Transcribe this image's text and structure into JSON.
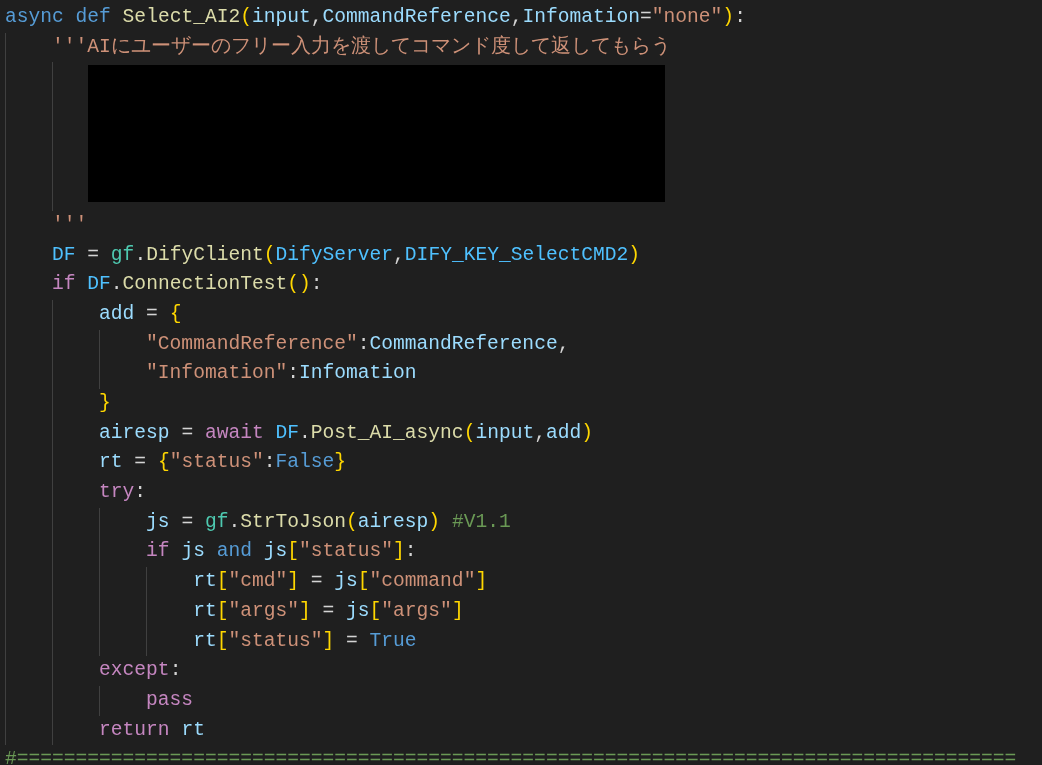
{
  "editor": {
    "lines": [
      {
        "kind": "code",
        "tokens": [
          {
            "kind": "keyword",
            "text": "async "
          },
          {
            "kind": "keyword",
            "text": "def "
          },
          {
            "kind": "function",
            "text": "Select_AI2"
          },
          {
            "kind": "bracket",
            "text": "("
          },
          {
            "kind": "variable",
            "text": "input"
          },
          {
            "kind": "plain",
            "text": ","
          },
          {
            "kind": "variable",
            "text": "CommandReference"
          },
          {
            "kind": "plain",
            "text": ","
          },
          {
            "kind": "variable",
            "text": "Infomation"
          },
          {
            "kind": "plain",
            "text": "="
          },
          {
            "kind": "string",
            "text": "\"none\""
          },
          {
            "kind": "bracket",
            "text": ")"
          },
          {
            "kind": "plain",
            "text": ":"
          }
        ],
        "children": [
          {
            "kind": "code",
            "tokens": [
              {
                "kind": "string",
                "text": "'''AIにユーザーのフリー入力を渡してコマンド度して返してもらう"
              }
            ],
            "children": [
              {
                "kind": "redacted"
              }
            ]
          },
          {
            "kind": "code",
            "tokens": [
              {
                "kind": "string",
                "text": "'''"
              }
            ]
          },
          {
            "kind": "code",
            "tokens": [
              {
                "kind": "constant",
                "text": "DF"
              },
              {
                "kind": "plain",
                "text": " = "
              },
              {
                "kind": "module",
                "text": "gf"
              },
              {
                "kind": "plain",
                "text": "."
              },
              {
                "kind": "function",
                "text": "DifyClient"
              },
              {
                "kind": "bracket",
                "text": "("
              },
              {
                "kind": "constant",
                "text": "DifyServer"
              },
              {
                "kind": "plain",
                "text": ","
              },
              {
                "kind": "constant",
                "text": "DIFY_KEY_SelectCMD2"
              },
              {
                "kind": "bracket",
                "text": ")"
              }
            ]
          },
          {
            "kind": "code",
            "tokens": [
              {
                "kind": "control",
                "text": "if "
              },
              {
                "kind": "constant",
                "text": "DF"
              },
              {
                "kind": "plain",
                "text": "."
              },
              {
                "kind": "function",
                "text": "ConnectionTest"
              },
              {
                "kind": "bracket",
                "text": "()"
              },
              {
                "kind": "plain",
                "text": ":"
              }
            ],
            "children": [
              {
                "kind": "code",
                "tokens": [
                  {
                    "kind": "variable",
                    "text": "add"
                  },
                  {
                    "kind": "plain",
                    "text": " = "
                  },
                  {
                    "kind": "bracket",
                    "text": "{"
                  }
                ],
                "children": [
                  {
                    "kind": "code",
                    "tokens": [
                      {
                        "kind": "string",
                        "text": "\"CommandReference\""
                      },
                      {
                        "kind": "plain",
                        "text": ":"
                      },
                      {
                        "kind": "variable",
                        "text": "CommandReference"
                      },
                      {
                        "kind": "plain",
                        "text": ","
                      }
                    ]
                  },
                  {
                    "kind": "code",
                    "tokens": [
                      {
                        "kind": "string",
                        "text": "\"Infomation\""
                      },
                      {
                        "kind": "plain",
                        "text": ":"
                      },
                      {
                        "kind": "variable",
                        "text": "Infomation"
                      }
                    ]
                  }
                ]
              },
              {
                "kind": "code",
                "tokens": [
                  {
                    "kind": "bracket",
                    "text": "}"
                  }
                ]
              },
              {
                "kind": "code",
                "tokens": [
                  {
                    "kind": "variable",
                    "text": "airesp"
                  },
                  {
                    "kind": "plain",
                    "text": " = "
                  },
                  {
                    "kind": "control",
                    "text": "await "
                  },
                  {
                    "kind": "constant",
                    "text": "DF"
                  },
                  {
                    "kind": "plain",
                    "text": "."
                  },
                  {
                    "kind": "function",
                    "text": "Post_AI_async"
                  },
                  {
                    "kind": "bracket",
                    "text": "("
                  },
                  {
                    "kind": "variable",
                    "text": "input"
                  },
                  {
                    "kind": "plain",
                    "text": ","
                  },
                  {
                    "kind": "variable",
                    "text": "add"
                  },
                  {
                    "kind": "bracket",
                    "text": ")"
                  }
                ]
              },
              {
                "kind": "code",
                "tokens": [
                  {
                    "kind": "variable",
                    "text": "rt"
                  },
                  {
                    "kind": "plain",
                    "text": " = "
                  },
                  {
                    "kind": "bracket",
                    "text": "{"
                  },
                  {
                    "kind": "string",
                    "text": "\"status\""
                  },
                  {
                    "kind": "plain",
                    "text": ":"
                  },
                  {
                    "kind": "keyword",
                    "text": "False"
                  },
                  {
                    "kind": "bracket",
                    "text": "}"
                  }
                ]
              },
              {
                "kind": "code",
                "tokens": [
                  {
                    "kind": "control",
                    "text": "try"
                  },
                  {
                    "kind": "plain",
                    "text": ":"
                  }
                ],
                "children": [
                  {
                    "kind": "code",
                    "tokens": [
                      {
                        "kind": "variable",
                        "text": "js"
                      },
                      {
                        "kind": "plain",
                        "text": " = "
                      },
                      {
                        "kind": "module",
                        "text": "gf"
                      },
                      {
                        "kind": "plain",
                        "text": "."
                      },
                      {
                        "kind": "function",
                        "text": "StrToJson"
                      },
                      {
                        "kind": "bracket",
                        "text": "("
                      },
                      {
                        "kind": "variable",
                        "text": "airesp"
                      },
                      {
                        "kind": "bracket",
                        "text": ")"
                      },
                      {
                        "kind": "comment",
                        "text": " #V1.1"
                      }
                    ]
                  },
                  {
                    "kind": "code",
                    "tokens": [
                      {
                        "kind": "control",
                        "text": "if "
                      },
                      {
                        "kind": "variable",
                        "text": "js "
                      },
                      {
                        "kind": "keyword",
                        "text": "and "
                      },
                      {
                        "kind": "variable",
                        "text": "js"
                      },
                      {
                        "kind": "bracket",
                        "text": "["
                      },
                      {
                        "kind": "string",
                        "text": "\"status\""
                      },
                      {
                        "kind": "bracket",
                        "text": "]"
                      },
                      {
                        "kind": "plain",
                        "text": ":"
                      }
                    ],
                    "children": [
                      {
                        "kind": "code",
                        "tokens": [
                          {
                            "kind": "variable",
                            "text": "rt"
                          },
                          {
                            "kind": "bracket",
                            "text": "["
                          },
                          {
                            "kind": "string",
                            "text": "\"cmd\""
                          },
                          {
                            "kind": "bracket",
                            "text": "]"
                          },
                          {
                            "kind": "plain",
                            "text": " = "
                          },
                          {
                            "kind": "variable",
                            "text": "js"
                          },
                          {
                            "kind": "bracket",
                            "text": "["
                          },
                          {
                            "kind": "string",
                            "text": "\"command\""
                          },
                          {
                            "kind": "bracket",
                            "text": "]"
                          }
                        ]
                      },
                      {
                        "kind": "code",
                        "tokens": [
                          {
                            "kind": "variable",
                            "text": "rt"
                          },
                          {
                            "kind": "bracket",
                            "text": "["
                          },
                          {
                            "kind": "string",
                            "text": "\"args\""
                          },
                          {
                            "kind": "bracket",
                            "text": "]"
                          },
                          {
                            "kind": "plain",
                            "text": " = "
                          },
                          {
                            "kind": "variable",
                            "text": "js"
                          },
                          {
                            "kind": "bracket",
                            "text": "["
                          },
                          {
                            "kind": "string",
                            "text": "\"args\""
                          },
                          {
                            "kind": "bracket",
                            "text": "]"
                          }
                        ]
                      },
                      {
                        "kind": "code",
                        "tokens": [
                          {
                            "kind": "variable",
                            "text": "rt"
                          },
                          {
                            "kind": "bracket",
                            "text": "["
                          },
                          {
                            "kind": "string",
                            "text": "\"status\""
                          },
                          {
                            "kind": "bracket",
                            "text": "]"
                          },
                          {
                            "kind": "plain",
                            "text": " = "
                          },
                          {
                            "kind": "keyword",
                            "text": "True"
                          }
                        ]
                      }
                    ]
                  }
                ]
              },
              {
                "kind": "code",
                "tokens": [
                  {
                    "kind": "control",
                    "text": "except"
                  },
                  {
                    "kind": "plain",
                    "text": ":"
                  }
                ],
                "children": [
                  {
                    "kind": "code",
                    "tokens": [
                      {
                        "kind": "control",
                        "text": "pass"
                      }
                    ]
                  }
                ]
              },
              {
                "kind": "code",
                "tokens": [
                  {
                    "kind": "control",
                    "text": "return "
                  },
                  {
                    "kind": "variable",
                    "text": "rt"
                  }
                ]
              }
            ]
          }
        ]
      },
      {
        "kind": "code",
        "tokens": [
          {
            "kind": "comment",
            "text": "#====================================================================================="
          }
        ]
      }
    ]
  }
}
